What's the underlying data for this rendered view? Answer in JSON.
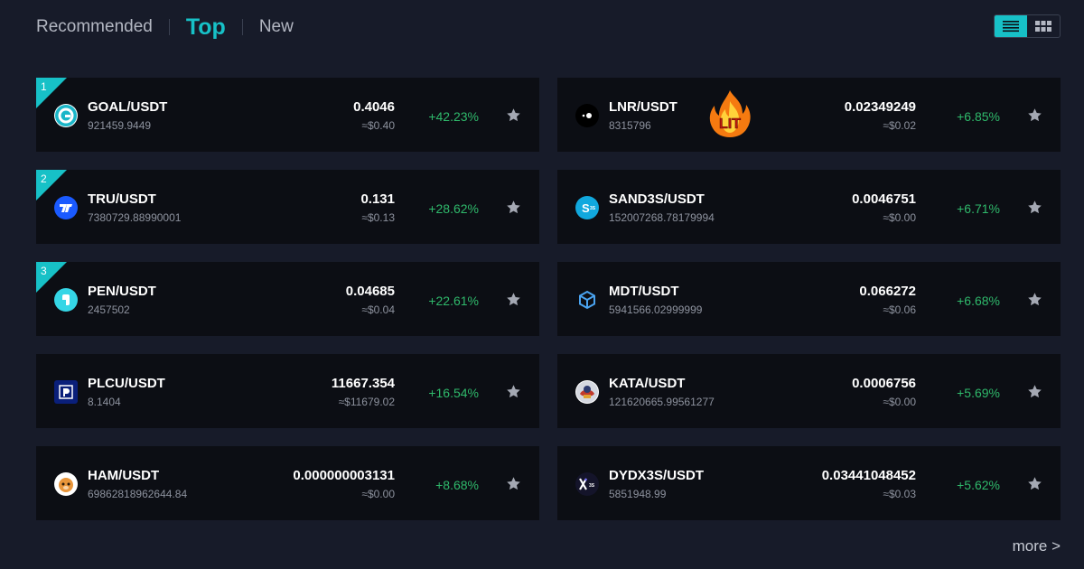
{
  "tabs": [
    {
      "label": "Recommended",
      "active": false
    },
    {
      "label": "Top",
      "active": true
    },
    {
      "label": "New",
      "active": false
    }
  ],
  "colors": {
    "accent": "#17c1c7",
    "positive": "#2fb96b",
    "card_bg": "#0c0e14",
    "page_bg": "#171b29"
  },
  "left_column": [
    {
      "rank": "1",
      "pair": "GOAL/USDT",
      "volume": "921459.9449",
      "price": "0.4046",
      "fiat": "≈$0.40",
      "change": "+42.23%",
      "icon": "goal-coin-icon"
    },
    {
      "rank": "2",
      "pair": "TRU/USDT",
      "volume": "7380729.88990001",
      "price": "0.131",
      "fiat": "≈$0.13",
      "change": "+28.62%",
      "icon": "tru-coin-icon"
    },
    {
      "rank": "3",
      "pair": "PEN/USDT",
      "volume": "2457502",
      "price": "0.04685",
      "fiat": "≈$0.04",
      "change": "+22.61%",
      "icon": "pen-coin-icon"
    },
    {
      "rank": "",
      "pair": "PLCU/USDT",
      "volume": "8.1404",
      "price": "11667.354",
      "fiat": "≈$11679.02",
      "change": "+16.54%",
      "icon": "plcu-coin-icon"
    },
    {
      "rank": "",
      "pair": "HAM/USDT",
      "volume": "69862818962644.84",
      "price": "0.000000003131",
      "fiat": "≈$0.00",
      "change": "+8.68%",
      "icon": "ham-coin-icon"
    }
  ],
  "right_column": [
    {
      "pair": "LNR/USDT",
      "volume": "8315796",
      "price": "0.02349249",
      "fiat": "≈$0.02",
      "change": "+6.85%",
      "icon": "lnr-coin-icon",
      "badge": "LIT"
    },
    {
      "pair": "SAND3S/USDT",
      "volume": "152007268.78179994",
      "price": "0.0046751",
      "fiat": "≈$0.00",
      "change": "+6.71%",
      "icon": "sand3s-coin-icon"
    },
    {
      "pair": "MDT/USDT",
      "volume": "5941566.02999999",
      "price": "0.066272",
      "fiat": "≈$0.06",
      "change": "+6.68%",
      "icon": "mdt-coin-icon"
    },
    {
      "pair": "KATA/USDT",
      "volume": "121620665.99561277",
      "price": "0.0006756",
      "fiat": "≈$0.00",
      "change": "+5.69%",
      "icon": "kata-coin-icon"
    },
    {
      "pair": "DYDX3S/USDT",
      "volume": "5851948.99",
      "price": "0.03441048452",
      "fiat": "≈$0.03",
      "change": "+5.62%",
      "icon": "dydx3s-coin-icon"
    }
  ],
  "more_link": "more >"
}
